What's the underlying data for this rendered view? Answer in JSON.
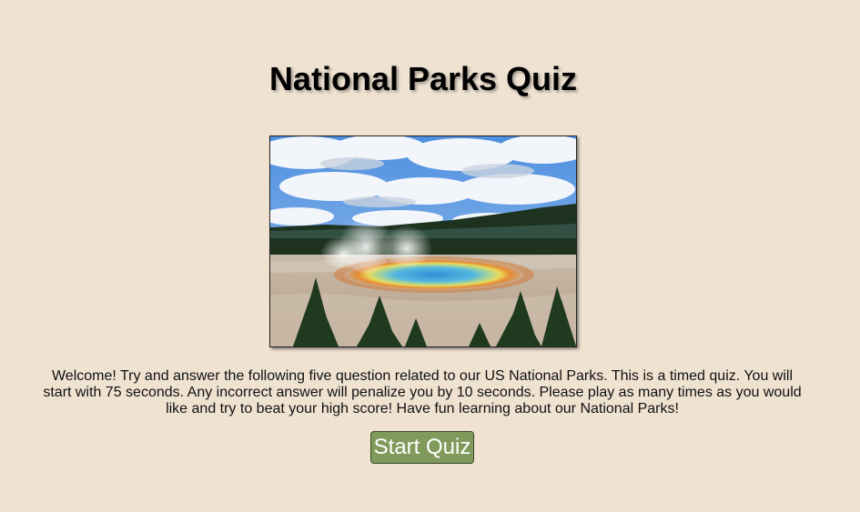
{
  "page": {
    "title": "National Parks Quiz"
  },
  "hero_image": {
    "subject": "Grand Prismatic Spring hot spring with steam, pine trees and cloudy blue sky",
    "colors": {
      "sky": "#5f9de8",
      "cloud": "#f3f6fb",
      "pool_center": "#3f9fd8",
      "pool_ring_yellow": "#e8d65a",
      "pool_ring_orange": "#e07b2e",
      "trees": "#1f3a1e"
    }
  },
  "intro": {
    "text": "Welcome! Try and answer the following five question related to our US National Parks. This is a timed quiz. You will start with 75 seconds. Any incorrect answer will penalize you by 10 seconds. Please play as many times as you would like and try to beat your high score! Have fun learning about our National Parks!"
  },
  "start_button": {
    "label": "Start Quiz",
    "color": "#7f9a5a"
  }
}
